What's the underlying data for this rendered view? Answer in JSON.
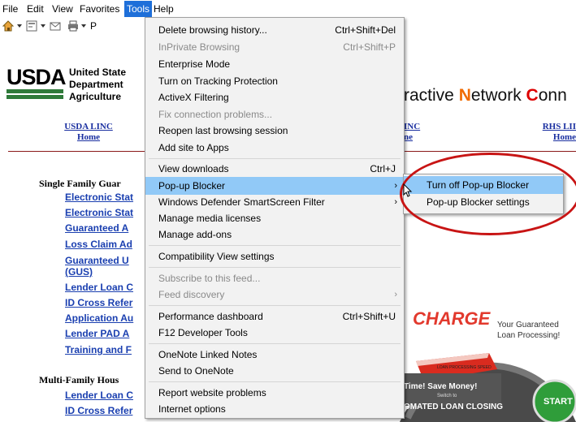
{
  "menubar": {
    "items": [
      "File",
      "Edit",
      "View",
      "Favorites",
      "Tools",
      "Help"
    ]
  },
  "toolbar": {
    "page_label": "P"
  },
  "page": {
    "logo": "USDA",
    "department": [
      "United State",
      "Department",
      "Agriculture"
    ],
    "linc_title": {
      "prefix": "ractive ",
      "n": "N",
      "etwork": "etwork ",
      "c": "C",
      "suffix": "onn"
    },
    "nav": [
      {
        "line1": "USDA LINC",
        "line2": "Home"
      },
      {
        "line1": "INC",
        "line2": "ne"
      },
      {
        "line1": "RHS LII",
        "line2": "Home"
      }
    ],
    "single_family_heading": "Single Family Guar",
    "single_family_links": [
      "Electronic Stat",
      "Electronic Stat",
      "Guaranteed A",
      "Loss Claim Ad",
      "Guaranteed U",
      "(GUS)",
      "Lender Loan C",
      "ID Cross Refer",
      "Application Au",
      "Lender PAD A",
      "Training and F"
    ],
    "multi_family_heading": "Multi-Family Hous",
    "multi_family_links": [
      "Lender Loan C",
      "ID Cross Refer"
    ],
    "banner": {
      "word": "CHARGE",
      "tagline": [
        "Your Guaranteed",
        "Loan Processing!"
      ],
      "gauge_label": "LOAN PROCESSING SPEED",
      "save_text": "Time!  Save Money!",
      "switch_text": "Switch to",
      "closing_text": "OMATED LOAN CLOSING",
      "start": "START"
    }
  },
  "tools_menu": {
    "items": [
      {
        "label": "Delete browsing history...",
        "shortcut": "Ctrl+Shift+Del",
        "disabled": false
      },
      {
        "label": "InPrivate Browsing",
        "shortcut": "Ctrl+Shift+P",
        "disabled": true
      },
      {
        "label": "Enterprise Mode",
        "shortcut": "",
        "disabled": false
      },
      {
        "label": "Turn on Tracking Protection",
        "shortcut": "",
        "disabled": false
      },
      {
        "label": "ActiveX Filtering",
        "shortcut": "",
        "disabled": false
      },
      {
        "label": "Fix connection problems...",
        "shortcut": "",
        "disabled": true
      },
      {
        "label": "Reopen last browsing session",
        "shortcut": "",
        "disabled": false
      },
      {
        "label": "Add site to Apps",
        "shortcut": "",
        "disabled": false
      },
      {
        "label": "View downloads",
        "shortcut": "Ctrl+J",
        "disabled": false
      },
      {
        "label": "Pop-up Blocker",
        "shortcut": "",
        "disabled": false,
        "submenu": true
      },
      {
        "label": "Windows Defender SmartScreen Filter",
        "shortcut": "",
        "disabled": false,
        "submenu": true
      },
      {
        "label": "Manage media licenses",
        "shortcut": "",
        "disabled": false
      },
      {
        "label": "Manage add-ons",
        "shortcut": "",
        "disabled": false
      },
      {
        "label": "Compatibility View settings",
        "shortcut": "",
        "disabled": false
      },
      {
        "label": "Subscribe to this feed...",
        "shortcut": "",
        "disabled": true
      },
      {
        "label": "Feed discovery",
        "shortcut": "",
        "disabled": true,
        "submenu": true
      },
      {
        "label": "Performance dashboard",
        "shortcut": "Ctrl+Shift+U",
        "disabled": false
      },
      {
        "label": "F12 Developer Tools",
        "shortcut": "",
        "disabled": false
      },
      {
        "label": "OneNote Linked Notes",
        "shortcut": "",
        "disabled": false
      },
      {
        "label": "Send to OneNote",
        "shortcut": "",
        "disabled": false
      },
      {
        "label": "Report website problems",
        "shortcut": "",
        "disabled": false
      },
      {
        "label": "Internet options",
        "shortcut": "",
        "disabled": false
      }
    ]
  },
  "popup_submenu": {
    "items": [
      "Turn off Pop-up Blocker",
      "Pop-up Blocker settings"
    ]
  },
  "colors": {
    "menu_highlight": "#91c9f7",
    "menubar_active": "#1e6fd9",
    "link": "#1a3fb0",
    "annotation": "#c81414"
  }
}
